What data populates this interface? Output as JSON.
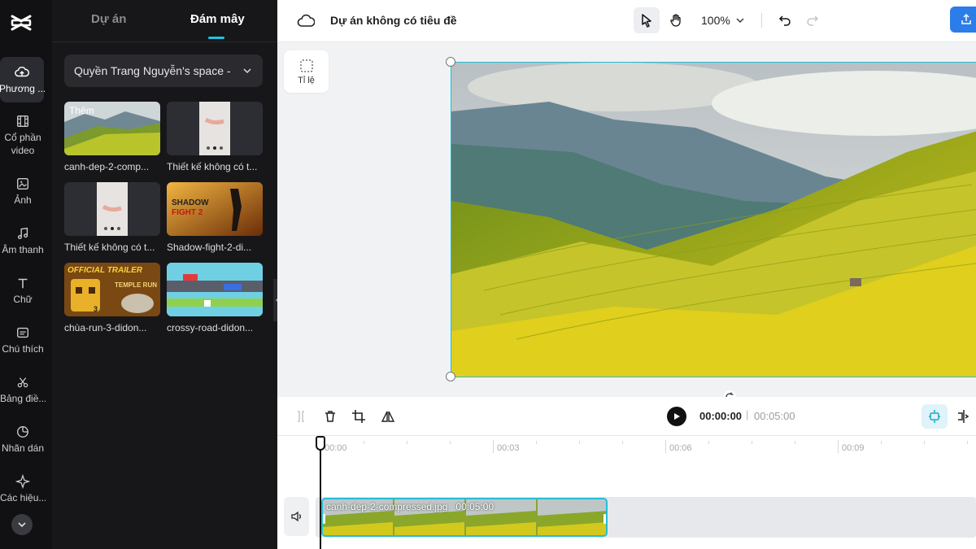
{
  "sidebar": {
    "items": [
      {
        "label": "Phương ...",
        "icon": "cloud-upload-icon"
      },
      {
        "label": "Cổ phần video",
        "label_line1": "Cổ phần",
        "label_line2": "video",
        "icon": "film-icon"
      },
      {
        "label": "Ảnh",
        "icon": "image-icon"
      },
      {
        "label": "Âm thanh",
        "icon": "music-note-icon"
      },
      {
        "label": "Chữ",
        "icon": "text-icon"
      },
      {
        "label": "Chú thích",
        "icon": "caption-icon"
      },
      {
        "label": "Bảng điề...",
        "icon": "scissors-icon"
      },
      {
        "label": "Nhãn dán",
        "icon": "sticker-icon"
      },
      {
        "label": "Các hiệu...",
        "icon": "sparkle-icon"
      }
    ]
  },
  "panel": {
    "tabs": [
      {
        "label": "Dự án",
        "active": false
      },
      {
        "label": "Đám mây",
        "active": true
      }
    ],
    "space_select": "Quyền Trang Nguyễn's space -",
    "media": [
      {
        "name": "canh-dep-2-comp...",
        "badge": "Thêm"
      },
      {
        "name": "Thiết kế không có t..."
      },
      {
        "name": "Thiết kế không có t..."
      },
      {
        "name": "Shadow-fight-2-di...",
        "thumb_text_1": "SHADOW",
        "thumb_text_2": "FIGHT 2"
      },
      {
        "name": "chùa-run-3-didon...",
        "thumb_text_1": "OFFICIAL TRAILER",
        "thumb_text_2": "TEMPLE RUN",
        "thumb_text_3": "3"
      },
      {
        "name": "crossy-road-didon..."
      }
    ]
  },
  "topbar": {
    "project_title": "Dự án không có tiêu đề",
    "zoom": "100%"
  },
  "canvas": {
    "ratio_label": "Tỉ lệ"
  },
  "timeline": {
    "current_time": "00:00:00",
    "separator": "|",
    "total_time": "00:05:00",
    "ruler": [
      "00:00",
      "00:03",
      "00:06",
      "00:09"
    ],
    "clip": {
      "name": "canh-dep-2-compressed.jpg",
      "duration": "00:05:00"
    }
  },
  "colors": {
    "accent": "#27bcd6",
    "tab_underline": "#22c3e6",
    "export_blue": "#2b7de9",
    "rail_bg": "#111113",
    "panel_bg": "#17171a"
  }
}
